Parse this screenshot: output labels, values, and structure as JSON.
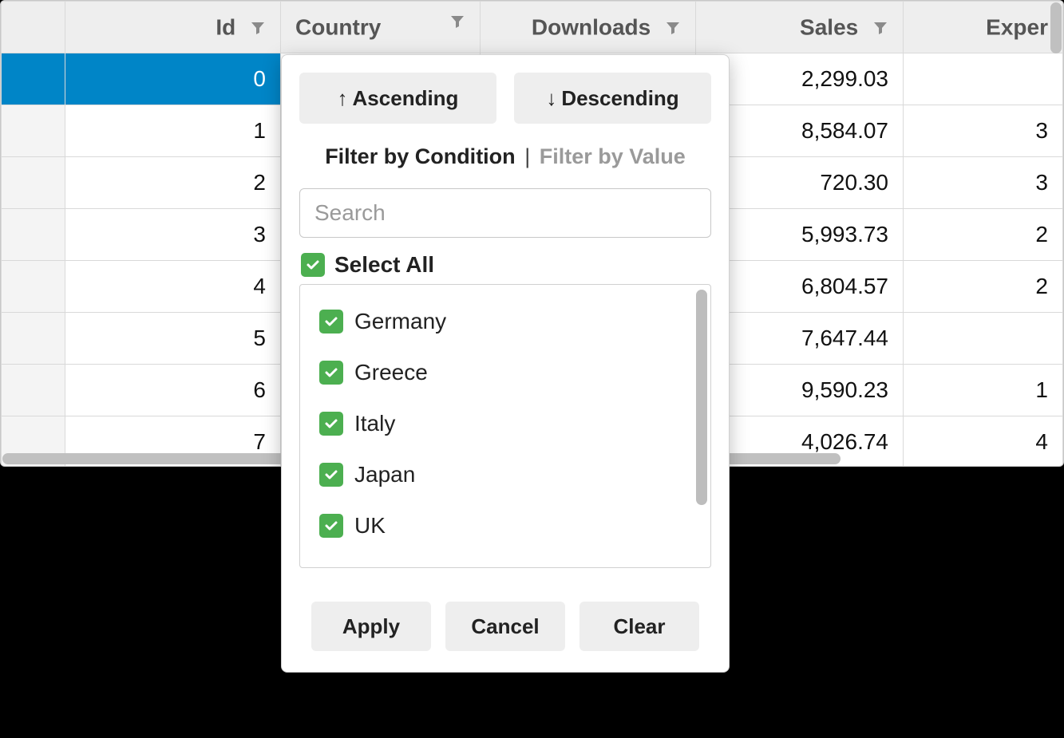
{
  "columns": {
    "id": "Id",
    "country": "Country",
    "downloads": "Downloads",
    "sales": "Sales",
    "expenses": "Exper"
  },
  "rows": [
    {
      "id": "0",
      "sales": "2,299.03",
      "exp": "",
      "selected": true
    },
    {
      "id": "1",
      "sales": "8,584.07",
      "exp": "3"
    },
    {
      "id": "2",
      "sales": "720.30",
      "exp": "3"
    },
    {
      "id": "3",
      "sales": "5,993.73",
      "exp": "2"
    },
    {
      "id": "4",
      "sales": "6,804.57",
      "exp": "2"
    },
    {
      "id": "5",
      "sales": "7,647.44",
      "exp": ""
    },
    {
      "id": "6",
      "sales": "9,590.23",
      "exp": "1"
    },
    {
      "id": "7",
      "sales": "4,026.74",
      "exp": "4"
    }
  ],
  "popup": {
    "sort_asc": "Ascending",
    "sort_desc": "Descending",
    "mode_condition": "Filter by Condition",
    "mode_sep": "|",
    "mode_value": "Filter by Value",
    "search_placeholder": "Search",
    "select_all": "Select All",
    "values": [
      "Germany",
      "Greece",
      "Italy",
      "Japan",
      "UK"
    ],
    "apply": "Apply",
    "cancel": "Cancel",
    "clear": "Clear"
  }
}
